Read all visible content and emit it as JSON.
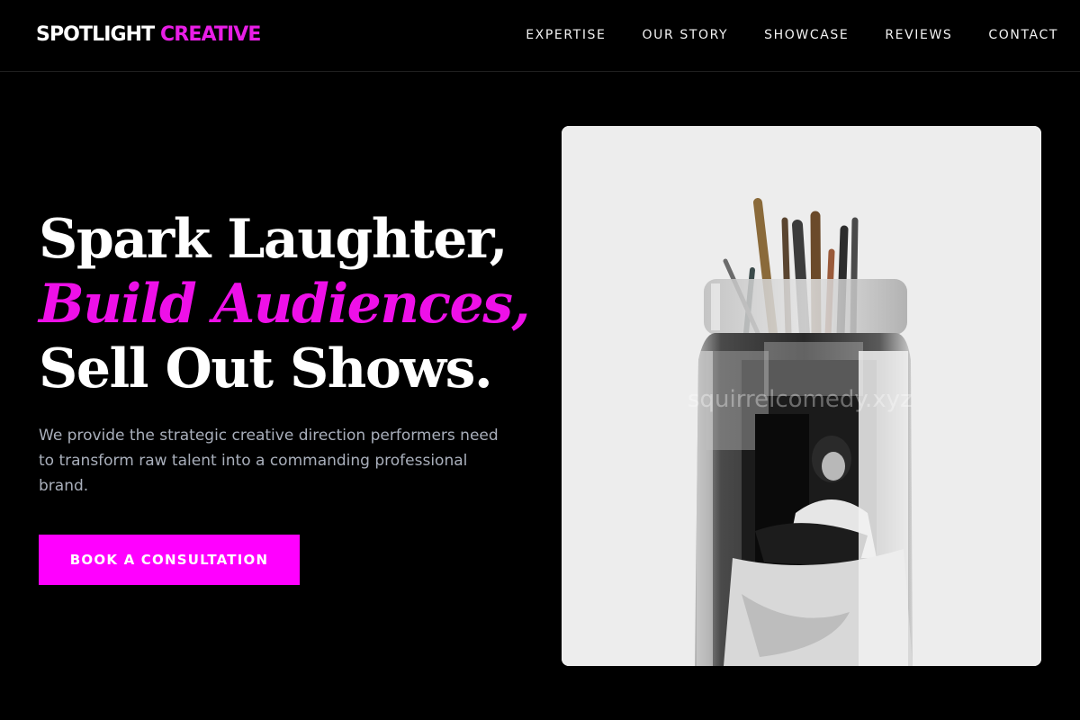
{
  "brand": {
    "name_part1": "SPOTLIGHT",
    "name_part2": "CREATIVE"
  },
  "nav": {
    "items": [
      {
        "label": "EXPERTISE"
      },
      {
        "label": "OUR STORY"
      },
      {
        "label": "SHOWCASE"
      },
      {
        "label": "REVIEWS"
      },
      {
        "label": "CONTACT"
      }
    ]
  },
  "hero": {
    "headline_line1": "Spark Laughter,",
    "headline_line2": "Build Audiences,",
    "headline_line3": "Sell Out Shows.",
    "description": "We provide the strategic creative direction performers need to transform raw talent into a commanding professional brand.",
    "cta_label": "BOOK A CONSULTATION",
    "image_watermark": "squirrelcomedy.xyz"
  },
  "colors": {
    "background": "#000000",
    "accent": "#ff00ff",
    "text": "#ffffff",
    "muted": "#a9afbb"
  }
}
